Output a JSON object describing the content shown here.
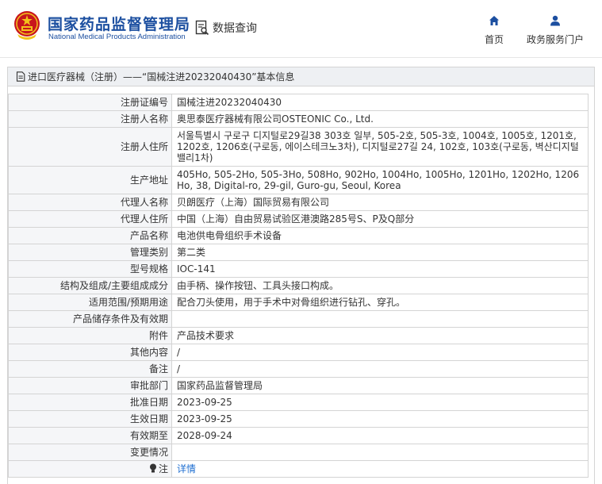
{
  "header": {
    "site_name_cn": "国家药品监督管理局",
    "site_name_en": "National Medical Products Administration",
    "query_label": "数据查询",
    "nav": [
      {
        "label": "首页",
        "icon": "home-icon"
      },
      {
        "label": "政务服务门户",
        "icon": "user-icon"
      }
    ]
  },
  "colors": {
    "brand_blue": "#1c4fa0",
    "link_blue": "#1f6fd1",
    "header_bg": "#eef0f3",
    "label_bg": "#f5f6f8",
    "border": "#d4d4d4",
    "emblem_red": "#c8161d",
    "emblem_gold": "#f3c21b"
  },
  "panel": {
    "title": "进口医疗器械（注册）——“国械注进20232040430”基本信息"
  },
  "fields": [
    {
      "label": "注册证编号",
      "value": "国械注进20232040430"
    },
    {
      "label": "注册人名称",
      "value": "奥思泰医疗器械有限公司OSTEONIC Co., Ltd."
    },
    {
      "label": "注册人住所",
      "value": "서울특별시 구로구 디지털로29길38 303호 일부, 505-2호, 505-3호, 1004호, 1005호, 1201호, 1202호, 1206호(구로동, 에이스테크노3차), 디지털로27길 24, 102호, 103호(구로동, 벽산디지털밸리1차)"
    },
    {
      "label": "生产地址",
      "value": "405Ho, 505-2Ho, 505-3Ho, 508Ho, 902Ho, 1004Ho, 1005Ho, 1201Ho, 1202Ho, 1206Ho, 38, Digital-ro, 29-gil, Guro-gu, Seoul, Korea"
    },
    {
      "label": "代理人名称",
      "value": "贝朗医疗（上海）国际贸易有限公司"
    },
    {
      "label": "代理人住所",
      "value": "中国（上海）自由贸易试验区港澳路285号S、P及Q部分"
    },
    {
      "label": "产品名称",
      "value": "电池供电骨组织手术设备"
    },
    {
      "label": "管理类别",
      "value": "第二类"
    },
    {
      "label": "型号规格",
      "value": "IOC-141"
    },
    {
      "label": "结构及组成/主要组成成分",
      "value": "由手柄、操作按钮、工具头接口构成。"
    },
    {
      "label": "适用范围/预期用途",
      "value": "配合刀头使用，用于手术中对骨组织进行钻孔、穿孔。"
    },
    {
      "label": "产品储存条件及有效期",
      "value": ""
    },
    {
      "label": "附件",
      "value": "产品技术要求"
    },
    {
      "label": "其他内容",
      "value": "/"
    },
    {
      "label": "备注",
      "value": "/"
    },
    {
      "label": "审批部门",
      "value": "国家药品监督管理局"
    },
    {
      "label": "批准日期",
      "value": "2023-09-25"
    },
    {
      "label": "生效日期",
      "value": "2023-09-25"
    },
    {
      "label": "有效期至",
      "value": "2028-09-24"
    },
    {
      "label": "变更情况",
      "value": ""
    }
  ],
  "note_row": {
    "label": "注",
    "icon": "lightbulb-icon",
    "link_text": "详情"
  }
}
